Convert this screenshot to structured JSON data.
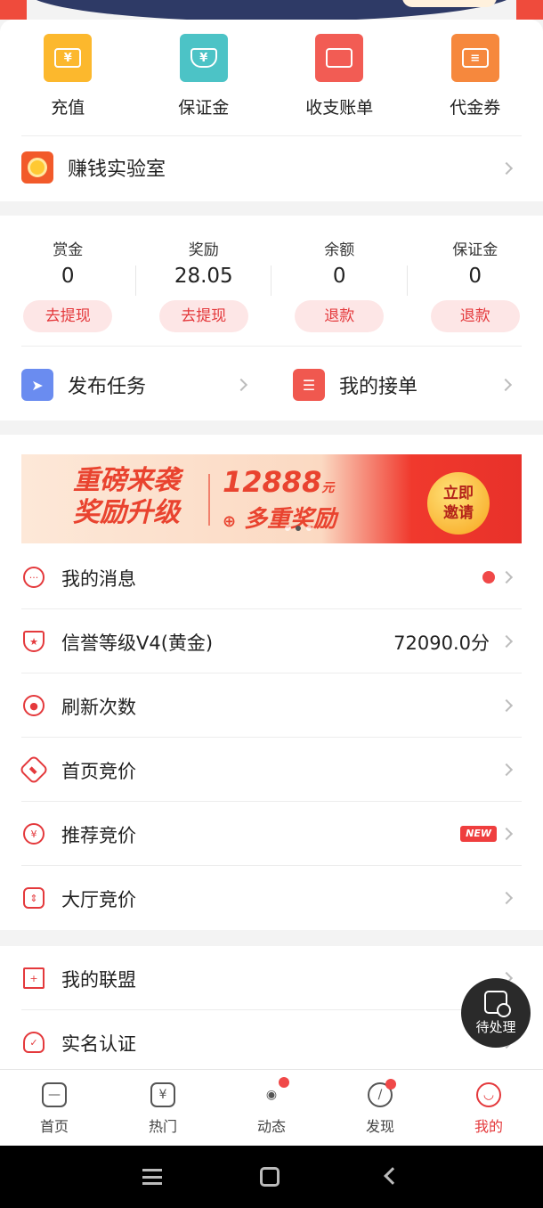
{
  "quick_actions": [
    {
      "label": "充值",
      "icon": "recharge-icon",
      "color": "#fcb82d",
      "glyph": "¥"
    },
    {
      "label": "保证金",
      "icon": "deposit-shield-icon",
      "color": "#4cc3c6",
      "glyph": "¥"
    },
    {
      "label": "收支账单",
      "icon": "wallet-icon",
      "color": "#f25c54",
      "glyph": ""
    },
    {
      "label": "代金券",
      "icon": "voucher-icon",
      "color": "#f6883d",
      "glyph": "≡"
    }
  ],
  "lab": {
    "label": "赚钱实验室"
  },
  "stats": [
    {
      "title": "赏金",
      "value": "0",
      "action": "去提现"
    },
    {
      "title": "奖励",
      "value": "28.05",
      "action": "去提现"
    },
    {
      "title": "余额",
      "value": "0",
      "action": "退款"
    },
    {
      "title": "保证金",
      "value": "0",
      "action": "退款"
    }
  ],
  "actions": {
    "publish": "发布任务",
    "my_orders": "我的接单"
  },
  "banner": {
    "line1": "重磅来袭",
    "line2": "奖励升级",
    "amount": "12888",
    "unit": "元",
    "sub": "多重奖励",
    "cta1": "立即",
    "cta2": "邀请"
  },
  "menu": [
    {
      "label": "我的消息",
      "icon": "message-icon",
      "right": "",
      "dot": true
    },
    {
      "label": "信誉等级V4(黄金)",
      "icon": "credit-star-icon",
      "right": "72090.0分"
    },
    {
      "label": "刷新次数",
      "icon": "refresh-icon",
      "right": ""
    },
    {
      "label": "首页竞价",
      "icon": "auction-hammer-icon",
      "right": ""
    },
    {
      "label": "推荐竞价",
      "icon": "recommend-bid-icon",
      "right": "",
      "tag": "NEW"
    },
    {
      "label": "大厅竞价",
      "icon": "hall-bid-icon",
      "right": ""
    }
  ],
  "menu2": [
    {
      "label": "我的联盟",
      "icon": "bookmark-icon"
    },
    {
      "label": "实名认证",
      "icon": "user-verify-icon"
    }
  ],
  "float_button": {
    "label": "待处理"
  },
  "tabs": [
    {
      "label": "首页",
      "icon": "home-icon",
      "glyph": "—"
    },
    {
      "label": "热门",
      "icon": "hot-icon",
      "glyph": "¥"
    },
    {
      "label": "动态",
      "icon": "broadcast-icon",
      "glyph": "◉",
      "badge": true
    },
    {
      "label": "发现",
      "icon": "compass-icon",
      "glyph": "/",
      "badge": true
    },
    {
      "label": "我的",
      "icon": "profile-icon",
      "glyph": "◡",
      "active": true
    }
  ],
  "colors": {
    "accent": "#e4393c"
  }
}
